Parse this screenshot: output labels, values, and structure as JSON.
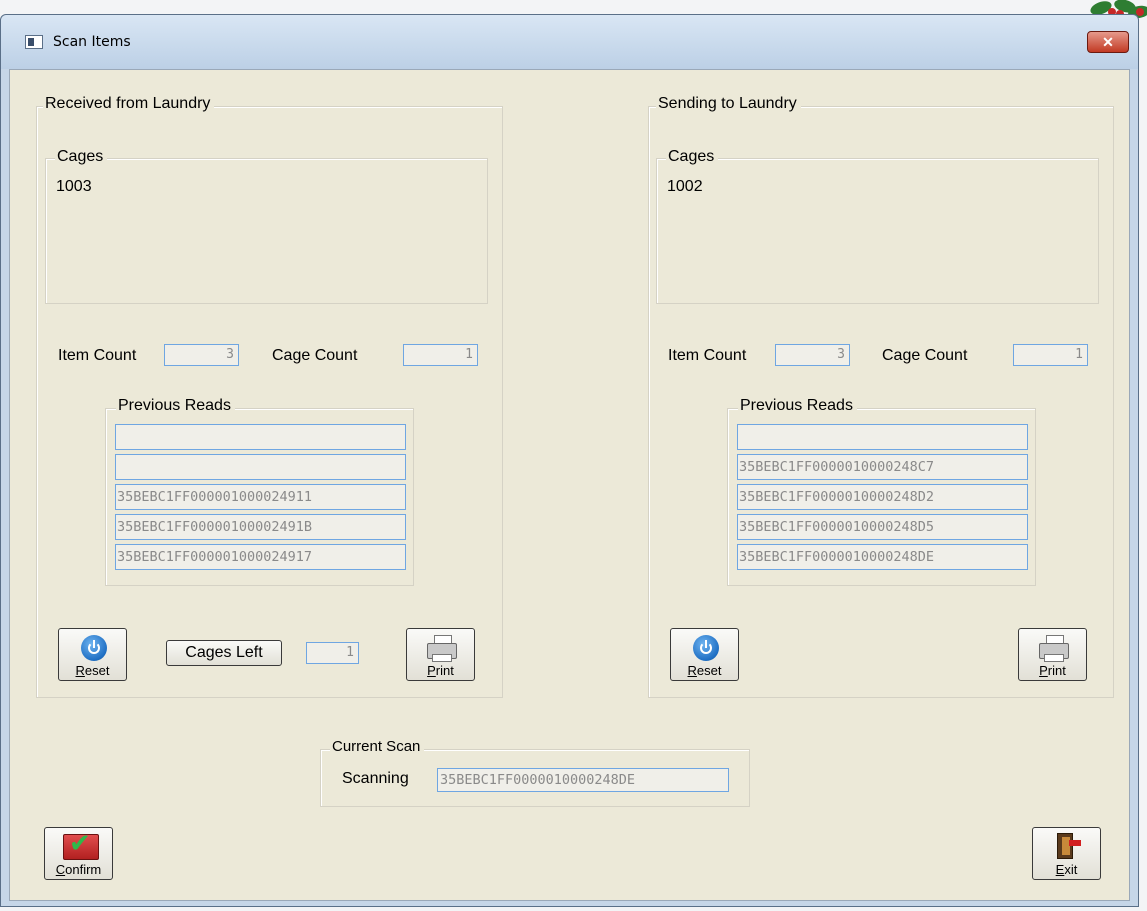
{
  "window": {
    "title": "Scan Items",
    "close_label": "✕"
  },
  "received": {
    "group_title": "Received from Laundry",
    "cages_title": "Cages",
    "cages": [
      "1003"
    ],
    "item_count_label": "Item Count",
    "item_count": "3",
    "cage_count_label": "Cage Count",
    "cage_count": "1",
    "previous_reads_title": "Previous Reads",
    "previous_reads": [
      "",
      "",
      "35BEBC1FF000001000024911",
      "35BEBC1FF00000100002491B",
      "35BEBC1FF000001000024917"
    ],
    "reset_label": "Reset",
    "cages_left_label": "Cages Left",
    "cages_left": "1",
    "print_label": "Print"
  },
  "sending": {
    "group_title": "Sending to Laundry",
    "cages_title": "Cages",
    "cages": [
      "1002"
    ],
    "item_count_label": "Item Count",
    "item_count": "3",
    "cage_count_label": "Cage Count",
    "cage_count": "1",
    "previous_reads_title": "Previous Reads",
    "previous_reads": [
      "",
      "35BEBC1FF0000010000248C7",
      "35BEBC1FF0000010000248D2",
      "35BEBC1FF0000010000248D5",
      "35BEBC1FF0000010000248DE"
    ],
    "reset_label": "Reset",
    "print_label": "Print"
  },
  "current_scan": {
    "group_title": "Current Scan",
    "scanning_label": "Scanning",
    "scanning_value": "35BEBC1FF0000010000248DE"
  },
  "footer": {
    "confirm_label": "Confirm",
    "exit_label": "Exit"
  },
  "colors": {
    "client_bg": "#ece9d8",
    "field_border": "#6fa6e2",
    "field_text": "#8a8a8a",
    "title_bar": "#c6d6e8"
  }
}
